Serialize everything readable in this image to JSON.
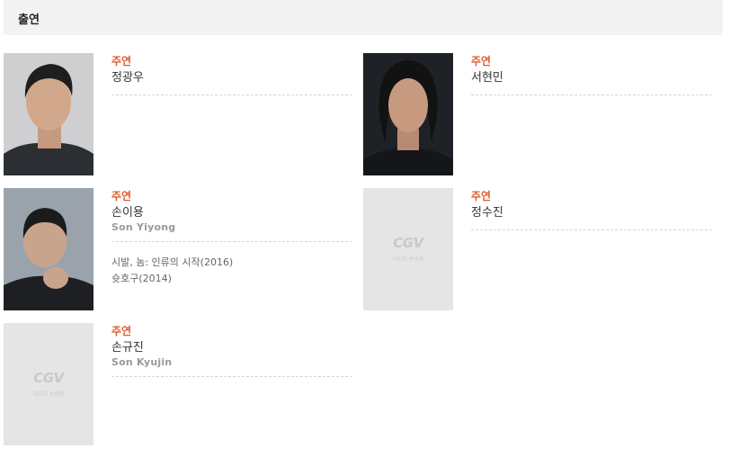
{
  "section": {
    "title": "출연"
  },
  "cast": [
    {
      "role": "주연",
      "name": "정광우",
      "english_name": "",
      "films": [],
      "photo": "actor-photo"
    },
    {
      "role": "주연",
      "name": "서현민",
      "english_name": "",
      "films": [],
      "photo": "actor-photo"
    },
    {
      "role": "주연",
      "name": "손이용",
      "english_name": "Son Yiyong",
      "films": [
        "시발, 놈: 인류의 시작(2016)",
        "슛호구(2014)"
      ],
      "photo": "actor-photo"
    },
    {
      "role": "주연",
      "name": "정수진",
      "english_name": "",
      "films": [],
      "photo": "placeholder"
    },
    {
      "role": "주연",
      "name": "손규진",
      "english_name": "Son Kyujin",
      "films": [],
      "photo": "placeholder"
    }
  ],
  "placeholder": {
    "logo": "CGV",
    "caption": "이미지 준비중"
  },
  "colors": {
    "role": "#e2582a",
    "header_bg": "#f3f3f3",
    "placeholder_bg": "#e5e5e5"
  }
}
